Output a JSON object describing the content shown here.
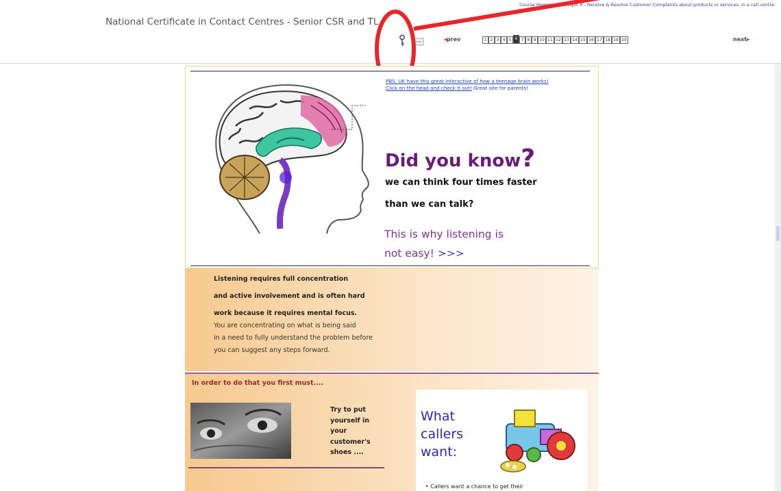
{
  "header": {
    "course_title": "National Certificate in Contact Centres - Senior CSR and TL",
    "breadcrumb": "Course Homepage > Topic 4 - Receive & Resolve Customer Complaints about products or services, in a call centre",
    "prev_label": "prev",
    "next_label": "next",
    "pages": [
      "1",
      "2",
      "3",
      "4",
      "5",
      "6",
      "7",
      "8",
      "9",
      "10",
      "11",
      "12",
      "13",
      "14",
      "15",
      "16",
      "17",
      "18",
      "19",
      "20"
    ],
    "current_page": "6",
    "icons": [
      "key-icon",
      "minimize-icon"
    ]
  },
  "content": {
    "pbs_link": "PBS, UK have this great interactive of how a teenage brain works! Click on the head and check it out!",
    "pbs_tail": " Great site for parents!",
    "did_you_know": "Did you know",
    "did_you_know_mark": "?",
    "think_line_1": "we can think four times faster",
    "think_line_2": "than we can talk?",
    "why_line_1": "This is why listening is",
    "why_line_2": "not easy!",
    "why_arrows": ">>>",
    "listen_bold_1": "Listening requires full concentration",
    "listen_bold_2": "and active involvement and is often hard",
    "listen_bold_3": "work because it requires mental focus.",
    "listen_plain_1": "You are concentrating on what is being said",
    "listen_plain_2": "in a need to fully understand the problem before",
    "listen_plain_3": "you can suggest any steps forward.",
    "in_order": "In order to do that you first must....",
    "try_text": "Try to put yourself in your customer's shoes ....",
    "what_callers_want": "What callers want:",
    "caller_bullet_1": "Callers want a chance to get their"
  },
  "colors": {
    "annotation": "#e8262a",
    "headline_purple": "#6b1a7a",
    "link_blue": "#1b3fc7",
    "panel_orange": "#f6c98e",
    "callers_blue": "#2a2ab8"
  }
}
